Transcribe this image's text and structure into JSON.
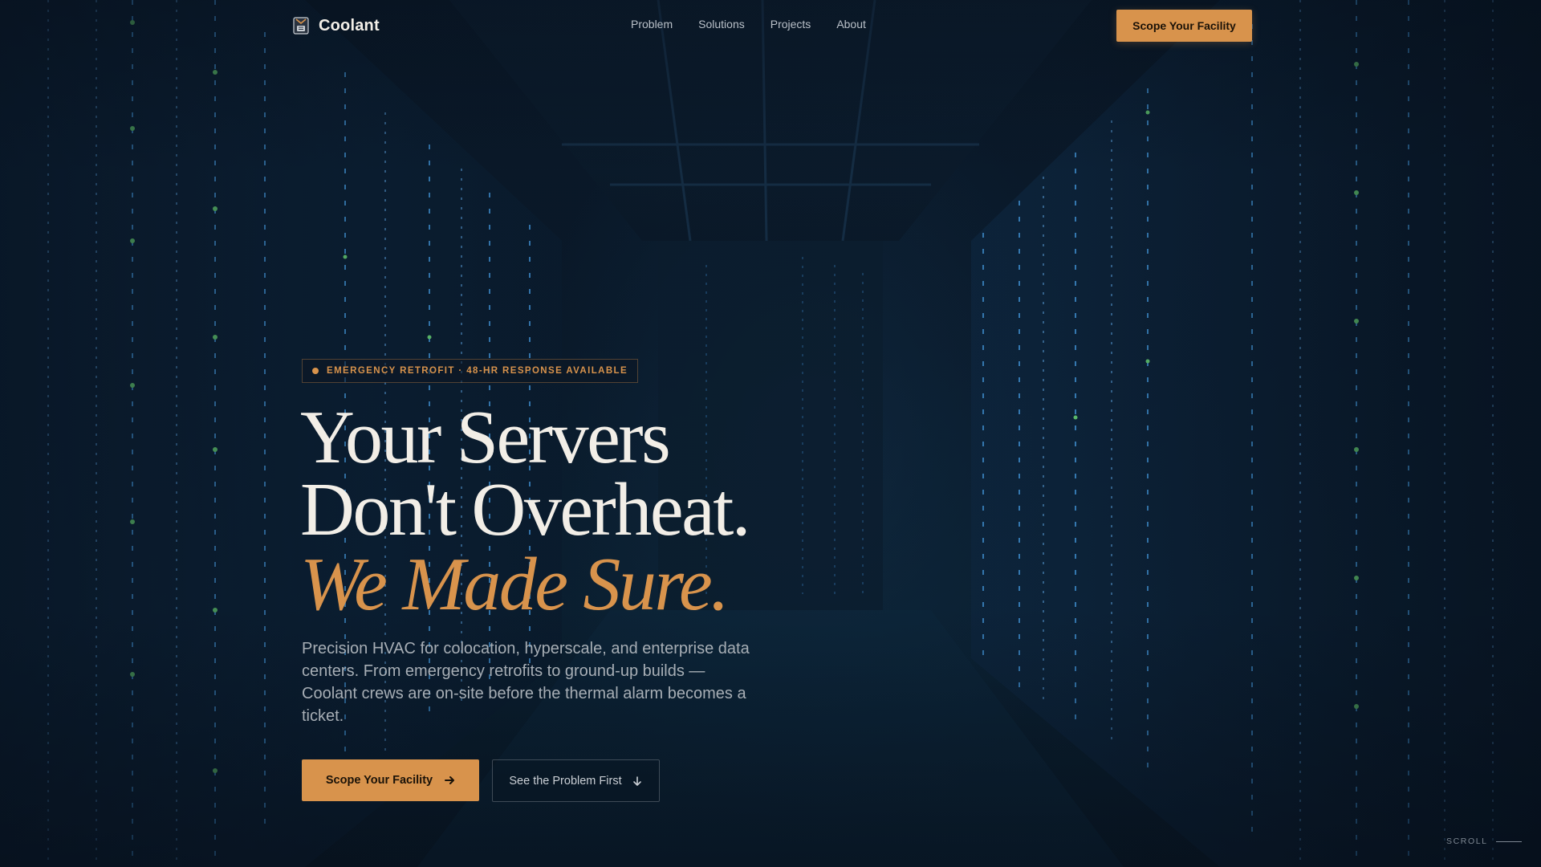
{
  "nav": {
    "brand": "Coolant",
    "links": [
      "Problem",
      "Solutions",
      "Projects",
      "About"
    ],
    "cta": "Scope Your Facility"
  },
  "hero": {
    "badge": "EMERGENCY RETROFIT · 48-HR RESPONSE AVAILABLE",
    "headline_line1": "Your Servers",
    "headline_line2": "Don't Overheat.",
    "headline_accent": "We Made Sure.",
    "description": "Precision HVAC for colocation, hyperscale, and enterprise data centers. From emergency retrofits to ground-up builds — Coolant crews are on-site before the thermal alarm becomes a ticket.",
    "primary_cta": "Scope Your Facility",
    "secondary_cta": "See the Problem First",
    "scroll_label": "SCROLL"
  },
  "icons": {
    "brand": "coolant-logo-icon",
    "primary_cta": "arrow-right-icon",
    "secondary_cta": "arrow-down-icon"
  },
  "colors": {
    "accent": "#d8934c",
    "background": "#0a1a2b",
    "headline": "#f2eee7",
    "body_text": "#a7aeb5"
  }
}
